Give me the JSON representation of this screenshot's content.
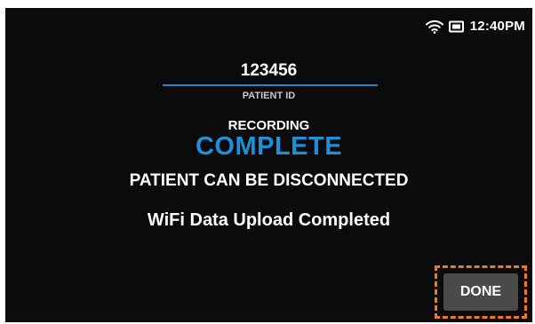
{
  "status": {
    "time": "12:40PM",
    "wifi_icon": "wifi-icon",
    "battery_icon": "battery-icon"
  },
  "patient": {
    "id_value": "123456",
    "id_label": "PATIENT ID"
  },
  "recording": {
    "label": "RECORDING",
    "state": "COMPLETE"
  },
  "messages": {
    "disconnect": "PATIENT CAN BE DISCONNECTED",
    "upload": "WiFi Data Upload Completed"
  },
  "actions": {
    "done_label": "DONE"
  },
  "colors": {
    "accent": "#1f8fd8",
    "background": "#0b0b0b",
    "highlight": "#f07a1a",
    "button": "#4a4a4a"
  }
}
